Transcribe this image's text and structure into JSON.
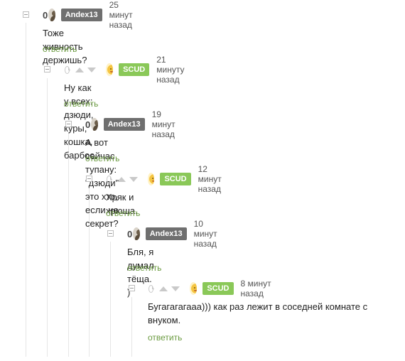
{
  "comments": [
    {
      "rating": "0",
      "author": "Andex13",
      "time": "25 минут назад",
      "text": "Тоже живность держишь?",
      "reply": "ответить"
    },
    {
      "author": "SCUD",
      "time": "21 минуту назад",
      "text": "Ну как у всех: дзюди, куры, кошка, барбос.",
      "reply": "ответить"
    },
    {
      "rating": "0",
      "author": "Andex13",
      "time": "19 минут назад",
      "text": "А вот сейчас тупану: \"дзюди\" это хто, если не секрет?",
      "reply": "ответить"
    },
    {
      "author": "SCUD",
      "time": "12 минут назад",
      "text": "Хряк и хрюша.",
      "reply": "ответить"
    },
    {
      "rating": "0",
      "author": "Andex13",
      "time": "10 минут назад",
      "text": "Бля, я думал тёща. )",
      "reply": "ответить"
    },
    {
      "author": "SCUD",
      "time": "8 минут назад",
      "text_line1": "Бугагагагааа))) как раз лежит в соседней комнате с",
      "text_line2": "внуком.",
      "reply": "ответить"
    }
  ],
  "colors": {
    "accent_green": "#8ac858",
    "nick_grey": "#6f6f6f",
    "reply_link": "#6a9a3f"
  },
  "icons": [
    "collapse-icon",
    "clock-icon",
    "upvote-icon",
    "downvote-icon",
    "avatar"
  ]
}
